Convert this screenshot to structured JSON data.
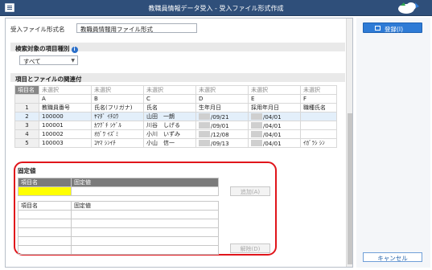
{
  "window": {
    "title": "教職員情報データ受入 - 受入ファイル形式作成"
  },
  "form": {
    "label": "受入ファイル形式名",
    "value": "教職員情報用ファイル形式"
  },
  "filter": {
    "section_title": "検索対象の項目種別",
    "info_icon": "i",
    "selected": "すべて"
  },
  "mapping": {
    "section_title": "項目とファイルの関連付",
    "corner_label": "項目名",
    "mapped_row": [
      "未選択",
      "未選択",
      "未選択",
      "未選択",
      "未選択",
      "未選択"
    ],
    "column_letters": [
      "A",
      "B",
      "C",
      "D",
      "E",
      "F"
    ],
    "rows": [
      {
        "num": "1",
        "cells": [
          "教職員番号",
          "氏名(フリガナ)",
          "氏名",
          "生年月日",
          "採用年月日",
          "職種氏名"
        ]
      },
      {
        "num": "2",
        "cells": [
          "100000",
          "ﾔﾏﾀﾞ ｲﾁﾛｳ",
          "山田　一朗",
          "/09/21",
          "/04/01",
          ""
        ]
      },
      {
        "num": "3",
        "cells": [
          "100001",
          "ｶﾜｸﾞﾁ ｼｹﾞﾙ",
          "川谷　しげる",
          "/09/01",
          "/04/01",
          ""
        ]
      },
      {
        "num": "4",
        "cells": [
          "100002",
          "ｵｶﾞﾜ ｲｽﾞﾐ",
          "小川　いずみ",
          "/12/08",
          "/04/01",
          ""
        ]
      },
      {
        "num": "5",
        "cells": [
          "100003",
          "ｺﾔﾏ ｼﾝｲﾁ",
          "小山　信一",
          "/09/13",
          "/04/01",
          "ｲｶﾞﾗｼ ｼﾝ"
        ]
      }
    ]
  },
  "fixed_values": {
    "section_title": "固定値",
    "header_item": "項目名",
    "header_value": "固定値",
    "add_button": "追加(A)",
    "list_header_item": "項目名",
    "list_header_value": "固定値",
    "remove_button": "解除(D)"
  },
  "actions": {
    "register": "登録(I)",
    "cancel": "キャンセル"
  },
  "colors": {
    "titlebar": "#2f4f7a",
    "accent": "#2e7bd6",
    "highlight_frame": "#e0151b",
    "input_highlight": "#ffff00"
  }
}
